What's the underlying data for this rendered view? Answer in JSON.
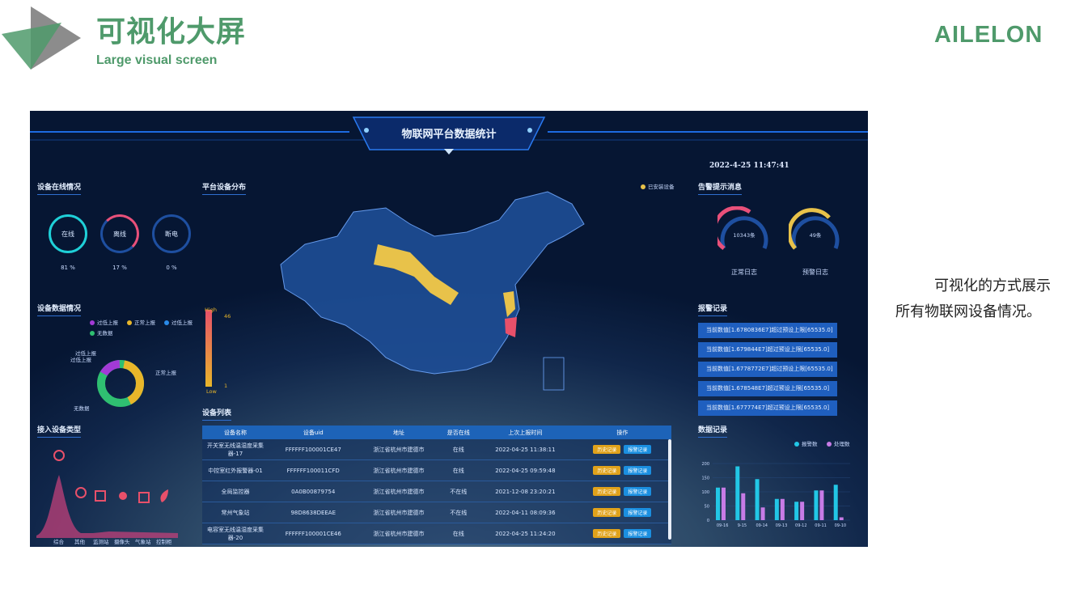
{
  "header": {
    "title": "可视化大屏",
    "subtitle": "Large visual screen",
    "brand": "AILELON"
  },
  "description": {
    "line1": "可视化的方式展示",
    "line2": "所有物联网设备情况。"
  },
  "dashboard": {
    "title": "物联网平台数据统计",
    "datetime": "2022-4-25 11:47:41",
    "online_panel": {
      "title": "设备在线情况",
      "rings": [
        {
          "label": "在线",
          "pct": "81 %",
          "value": 0.81
        },
        {
          "label": "离线",
          "pct": "17 %",
          "value": 0.17
        },
        {
          "label": "断电",
          "pct": "0 %",
          "value": 0
        }
      ]
    },
    "data_panel": {
      "title": "设备数据情况",
      "legend": [
        "过低上报",
        "正常上报",
        "过低上报",
        "无数据"
      ],
      "labels": {
        "low_a": "过低上报",
        "low_b": "过低上报",
        "normal": "正常上报",
        "none": "无数据"
      }
    },
    "type_panel": {
      "title": "接入设备类型",
      "categories": [
        "综合",
        "其他",
        "监测站",
        "摄像头",
        "气象站",
        "控制柜"
      ]
    },
    "map_panel": {
      "title": "平台设备分布",
      "legend": "已安装设备",
      "scale_high": "High",
      "scale_low": "Low",
      "scale_max": "46",
      "scale_min": "1"
    },
    "table": {
      "title": "设备列表",
      "columns": [
        "设备名称",
        "设备uid",
        "地址",
        "是否在线",
        "上次上报时间",
        "操作"
      ],
      "rows": [
        {
          "name": "开关室无线温湿度采集器-17",
          "uid": "FFFFFF100001CE47",
          "addr": "浙江省杭州市建德市",
          "online": "在线",
          "time": "2022-04-25 11:38:11"
        },
        {
          "name": "中控室红外报警器-01",
          "uid": "FFFFFF100011CFD",
          "addr": "浙江省杭州市建德市",
          "online": "在线",
          "time": "2022-04-25 09:59:48"
        },
        {
          "name": "全局监控器",
          "uid": "0A0B00879754",
          "addr": "浙江省杭州市建德市",
          "online": "不在线",
          "time": "2021-12-08 23:20:21"
        },
        {
          "name": "常州气象站",
          "uid": "98D8638DEEAE",
          "addr": "浙江省杭州市建德市",
          "online": "不在线",
          "time": "2022-04-11 08:09:36"
        },
        {
          "name": "电容室无线温湿度采集器-20",
          "uid": "FFFFFF100001CE46",
          "addr": "浙江省杭州市建德市",
          "online": "在线",
          "time": "2022-04-25 11:24:20"
        }
      ],
      "btn_history": "历史记录",
      "btn_alarm": "报警记录"
    },
    "alert_panel": {
      "title": "告警提示消息",
      "gauges": [
        {
          "value": "10343条",
          "label": "正常日志",
          "fill": 0.55
        },
        {
          "value": "49条",
          "label": "预警日志",
          "fill": 0.6
        }
      ]
    },
    "alarm_panel": {
      "title": "报警记录",
      "rows": [
        "当前数值[1.6780836E7]超过预设上限[65535.0]",
        "当前数值[1.679844E7]超过预设上限[65535.0]",
        "当前数值[1.6778772E7]超过预设上限[65535.0]",
        "当前数值[1.678548E7]超过预设上限[65535.0]",
        "当前数值[1.677774E7]超过预设上限[65535.0]"
      ]
    },
    "record_panel": {
      "title": "数据记录",
      "legend": [
        "报警数",
        "处理数"
      ],
      "colors": {
        "alarm": "#22c7e6",
        "handled": "#c77be6"
      }
    }
  },
  "chart_data": {
    "type": "bar",
    "categories": [
      "09-16",
      "9-15",
      "09-14",
      "09-13",
      "09-12",
      "09-11",
      "09-10"
    ],
    "series": [
      {
        "name": "报警数",
        "values": [
          115,
          190,
          145,
          75,
          65,
          105,
          125
        ]
      },
      {
        "name": "处理数",
        "values": [
          115,
          95,
          45,
          75,
          65,
          105,
          10
        ]
      }
    ],
    "yticks": [
      "200",
      "150",
      "100",
      "50",
      "0"
    ],
    "ylim": [
      0,
      200
    ]
  }
}
